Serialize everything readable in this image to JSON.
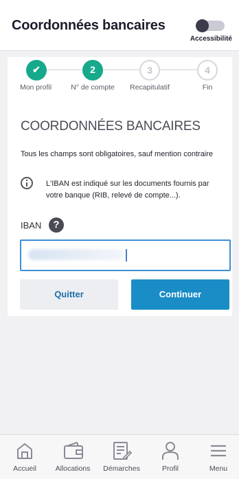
{
  "header": {
    "title": "Coordonnées bancaires",
    "accessibility_label": "Accessibilité"
  },
  "stepper": {
    "steps": [
      {
        "num": "✔",
        "label": "Mon profil",
        "state": "done"
      },
      {
        "num": "2",
        "label": "N° de compte",
        "state": "active"
      },
      {
        "num": "3",
        "label": "Recapitulatif",
        "state": "todo"
      },
      {
        "num": "4",
        "label": "Fin",
        "state": "todo"
      }
    ]
  },
  "form": {
    "section_title": "COORDONNÉES BANCAIRES",
    "intro": "Tous les champs sont obligatoires, sauf mention contraire",
    "info": "L'IBAN est indiqué sur les documents fournis par votre banque (RIB, relevé de compte...).",
    "iban_label": "IBAN",
    "help_symbol": "?",
    "quit_label": "Quitter",
    "continue_label": "Continuer"
  },
  "nav": {
    "items": [
      {
        "label": "Accueil",
        "icon": "home-icon"
      },
      {
        "label": "Allocations",
        "icon": "wallet-icon"
      },
      {
        "label": "Démarches",
        "icon": "document-edit-icon"
      },
      {
        "label": "Profil",
        "icon": "user-icon"
      },
      {
        "label": "Menu",
        "icon": "menu-icon"
      }
    ]
  },
  "colors": {
    "accent_green": "#16a98b",
    "primary_blue": "#1a8dc6",
    "input_border": "#3d8fd6"
  }
}
